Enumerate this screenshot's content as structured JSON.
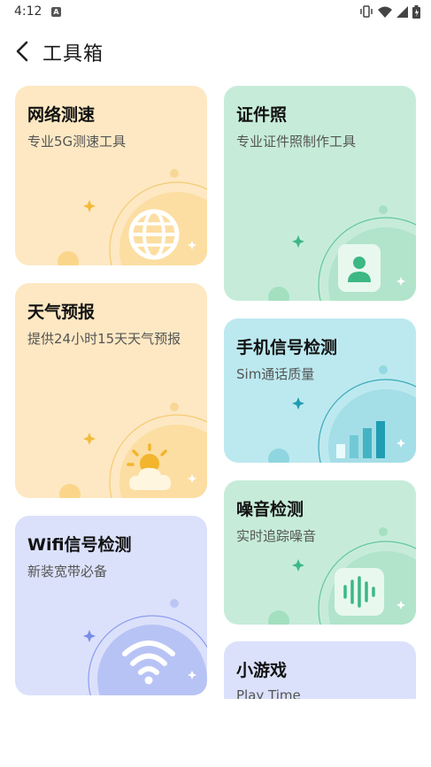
{
  "status_bar": {
    "time": "4:12",
    "icons": [
      "notification-a-icon",
      "vibrate-icon",
      "wifi-icon",
      "signal-icon",
      "battery-icon"
    ]
  },
  "header": {
    "title": "工具箱",
    "back_icon": "chevron-left-icon"
  },
  "cards": {
    "speed": {
      "title": "网络测速",
      "subtitle": "专业5G测速工具",
      "icon": "globe-icon",
      "color": "#fde8c3"
    },
    "weather": {
      "title": "天气预报",
      "subtitle": "提供24小时15天天气预报",
      "icon": "sun-cloud-icon",
      "color": "#fde8c3"
    },
    "wifi": {
      "title": "Wifi信号检测",
      "subtitle": "新装宽带必备",
      "icon": "wifi-icon",
      "color": "#dbe1fb"
    },
    "id_photo": {
      "title": "证件照",
      "subtitle": "专业证件照制作工具",
      "icon": "portrait-icon",
      "color": "#c6ecd9"
    },
    "phone_signal": {
      "title": "手机信号检测",
      "subtitle": "Sim通话质量",
      "icon": "signal-bars-icon",
      "color": "#bce9ef"
    },
    "noise": {
      "title": "噪音检测",
      "subtitle": "实时追踪噪音",
      "icon": "soundwave-icon",
      "color": "#c6ecd9"
    },
    "game": {
      "title": "小游戏",
      "subtitle": "Play Time",
      "icon": "",
      "color": "#dbe1fb"
    }
  }
}
